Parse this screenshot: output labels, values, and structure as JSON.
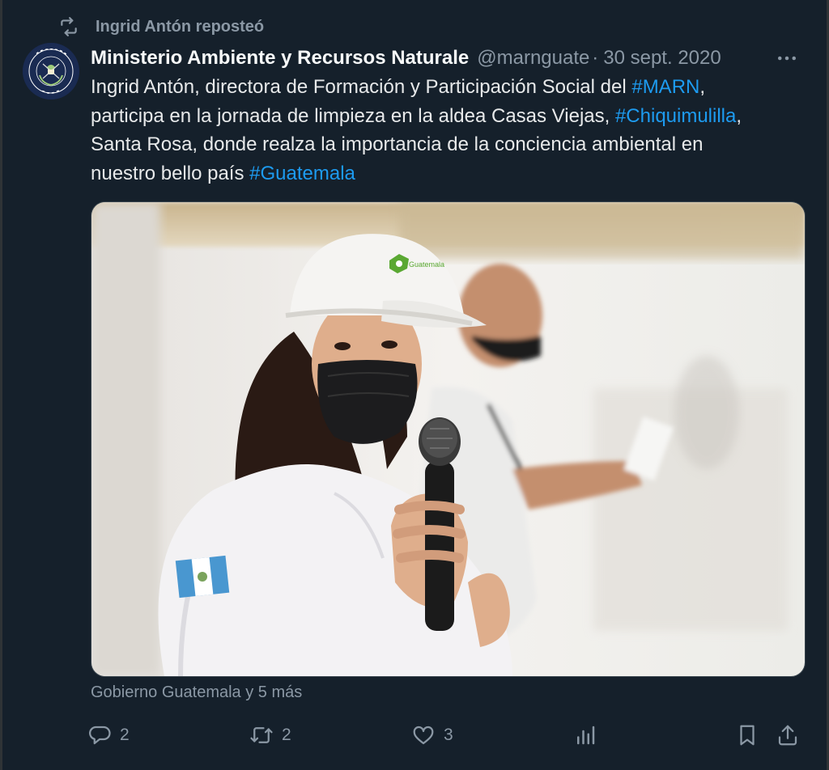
{
  "repost_line": {
    "text": "Ingrid Antón reposteó",
    "icon": "repost-icon"
  },
  "tweet": {
    "author": {
      "display_name": "Ministerio Ambiente y Recursos Naturale",
      "handle": "@marnguate",
      "avatar": "gobierno-de-la-republica-guatemala-seal"
    },
    "separator": "·",
    "timestamp": "30 sept. 2020",
    "more_icon": "more-icon",
    "text": {
      "line1_a": "Ingrid Antón, directora de Formación y Participación Social del ",
      "tag_marn": "#MARN",
      "line1_b": ",",
      "line2_a": "participa en la jornada de limpieza en la aldea Casas Viejas, ",
      "tag_chiqui": "#Chiquimulilla",
      "line2_b": ",",
      "line3": "Santa Rosa, donde realza la importancia de la conciencia ambiental en",
      "line4_a": "nuestro bello país ",
      "tag_gt": "#Guatemala"
    },
    "media": {
      "cap_logo_text": "Guatemala",
      "description_hidden": ""
    },
    "tagged_users": "Gobierno Guatemala y 5 más",
    "actions": {
      "replies": "2",
      "reposts": "2",
      "likes": "3"
    }
  },
  "colors": {
    "background": "#15202b",
    "text_primary": "#f7f9f9",
    "text_secondary": "#8b98a5",
    "link": "#1d9bf0"
  }
}
